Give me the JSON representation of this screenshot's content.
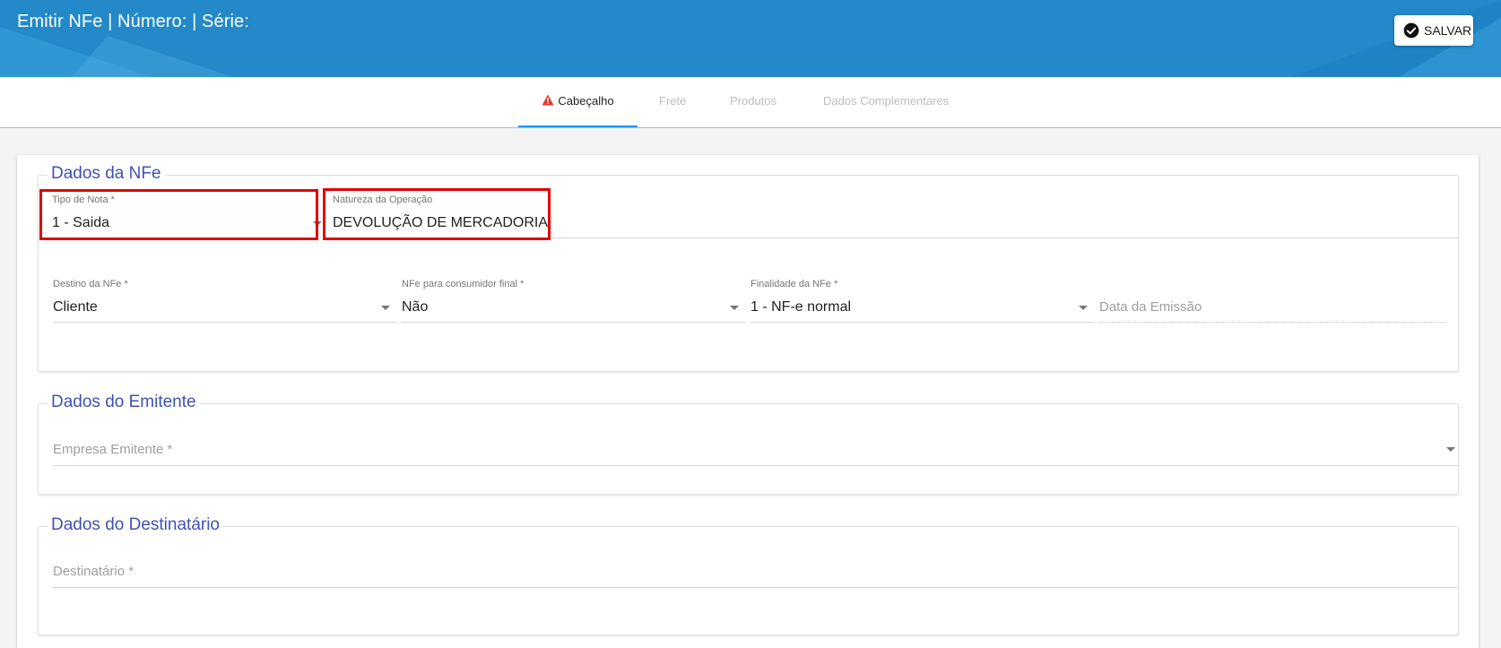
{
  "header": {
    "title": "Emitir NFe | Número: | Série:",
    "save_label": "SALVAR",
    "save_icon": "check-circle-icon",
    "background_color": "#2389c8"
  },
  "tabs": [
    {
      "label": "Cabeçalho",
      "active": true,
      "icon": "warning-icon"
    },
    {
      "label": "Frete",
      "active": false
    },
    {
      "label": "Produtos",
      "active": false
    },
    {
      "label": "Dados Complementares",
      "active": false
    }
  ],
  "sections": {
    "nfe": {
      "title": "Dados da NFe",
      "tipo_nota": {
        "label": "Tipo de Nota *",
        "value": "1 - Saida"
      },
      "natureza": {
        "label": "Natureza da Operação",
        "value": "DEVOLUÇÃO DE MERCADORIA"
      },
      "destino": {
        "label": "Destino da NFe *",
        "value": "Cliente"
      },
      "consumidor": {
        "label": "NFe para consumidor final *",
        "value": "Não"
      },
      "finalidade": {
        "label": "Finalidade da NFe *",
        "value": "1 - NF-e normal"
      },
      "data_emissao": {
        "placeholder": "Data da Emissão"
      }
    },
    "emitente": {
      "title": "Dados do Emitente",
      "empresa": {
        "placeholder": "Empresa Emitente *"
      }
    },
    "destinatario": {
      "title": "Dados do Destinatário",
      "destinatario": {
        "placeholder": "Destinatário *"
      }
    }
  },
  "colors": {
    "accent": "#2196f3",
    "legend": "#3f51b5",
    "highlight": "#e00000",
    "warning": "#e53935"
  }
}
